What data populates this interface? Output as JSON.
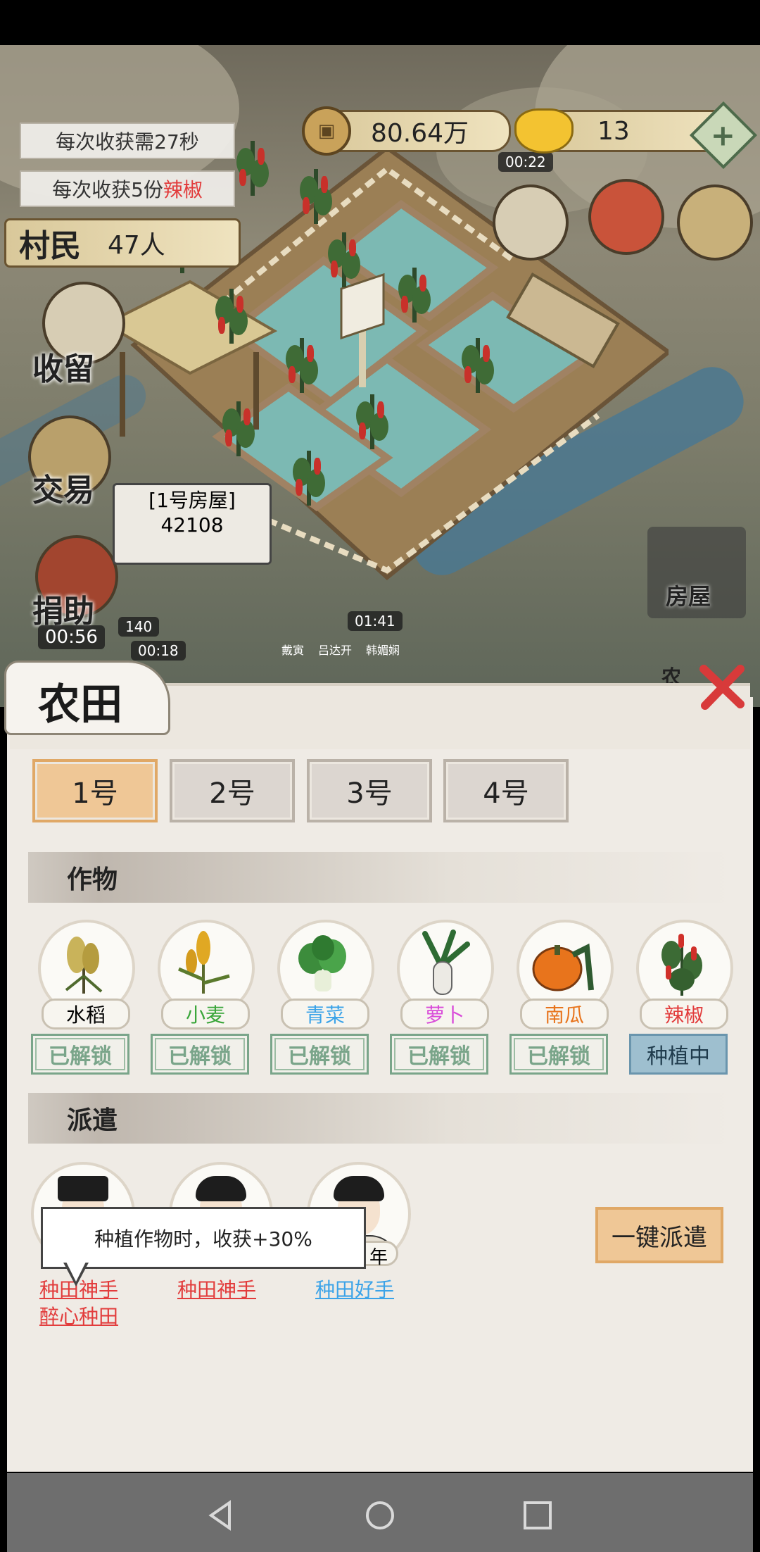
{
  "hud": {
    "harvest_time": "每次收获需27秒",
    "harvest_amount_prefix": "每次收获5份",
    "harvest_crop": "辣椒",
    "villagers_label": "村民",
    "villagers_count": "47人",
    "coins": "80.64万",
    "coin_timer": "00:22",
    "gold": "13"
  },
  "side_menu": {
    "shelter": "收留",
    "trade": "交易",
    "donate": "捐助",
    "donate_timer": "00:56"
  },
  "map_labels": {
    "house_bubble_title": "[1号房屋]",
    "house_bubble_value": "42108",
    "resource_small_value": "140",
    "resource_small_timer": "00:18",
    "center_timer": "01:41",
    "villager_1": "戴寅",
    "villager_2": "吕达开",
    "villager_3": "韩媚娴",
    "house_button": "房屋",
    "farm_button_partial": "农"
  },
  "panel": {
    "title": "农田",
    "tabs": [
      "1号",
      "2号",
      "3号",
      "4号"
    ],
    "active_tab": 0,
    "crops_header": "作物",
    "dispatch_header": "派遣",
    "crops": [
      {
        "name": "水稻",
        "status": "已解锁",
        "name_color": "#333333",
        "icon": "rice-icon"
      },
      {
        "name": "小麦",
        "status": "已解锁",
        "name_color": "#3aa63a",
        "icon": "wheat-icon"
      },
      {
        "name": "青菜",
        "status": "已解锁",
        "name_color": "#3ba3e8",
        "icon": "greens-icon"
      },
      {
        "name": "萝卜",
        "status": "已解锁",
        "name_color": "#d94bd9",
        "icon": "radish-icon"
      },
      {
        "name": "南瓜",
        "status": "已解锁",
        "name_color": "#e8741c",
        "icon": "pumpkin-icon"
      },
      {
        "name": "辣椒",
        "status": "种植中",
        "name_color": "#e23c3c",
        "icon": "pepper-icon"
      }
    ],
    "workers": [
      {
        "skills": [
          "种田神手",
          "醉心种田"
        ],
        "skill_color": "red"
      },
      {
        "skills": [
          "种田神手"
        ],
        "skill_color": "red"
      },
      {
        "name_partial": "年",
        "skills": [
          "种田好手"
        ],
        "skill_color": "blue"
      }
    ],
    "tooltip": "种植作物时，收获+30%",
    "dispatch_all_button": "一键派遣"
  },
  "navbar": {
    "back": "back-icon",
    "home": "home-icon",
    "recents": "recents-icon"
  },
  "colors": {
    "accent_tab": "#efc796",
    "unlocked_green": "#7aa58a",
    "planting_blue": "#9ebfcf",
    "red_text": "#e23c3c"
  }
}
